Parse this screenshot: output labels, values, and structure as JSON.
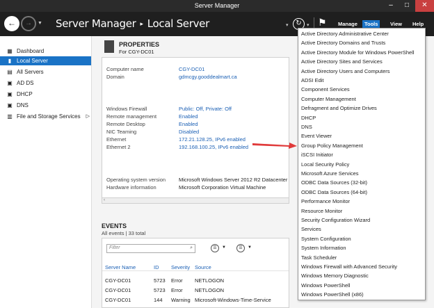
{
  "window": {
    "title": "Server Manager",
    "minimize": "–",
    "maximize": "□",
    "close": "✕"
  },
  "header": {
    "breadcrumb_root": "Server Manager",
    "breadcrumb_separator": "▸",
    "breadcrumb_current": "Local Server",
    "back_icon": "←",
    "forward_icon": "→",
    "nav_dropdown_icon": "▼",
    "breadcrumb_dropdown_icon": "▾",
    "refresh_icon": "↻",
    "refresh_dropdown_icon": "▾",
    "flag_icon": "⚑",
    "menus": [
      "Manage",
      "Tools",
      "View",
      "Help"
    ]
  },
  "sidebar": {
    "items": [
      {
        "label": "Dashboard",
        "icon": "▦",
        "active": false
      },
      {
        "label": "Local Server",
        "icon": "▮",
        "active": true
      },
      {
        "label": "All Servers",
        "icon": "▤",
        "active": false
      },
      {
        "label": "AD DS",
        "icon": "▣",
        "active": false
      },
      {
        "label": "DHCP",
        "icon": "▣",
        "active": false
      },
      {
        "label": "DNS",
        "icon": "▣",
        "active": false
      },
      {
        "label": "File and Storage Services",
        "icon": "▥",
        "active": false,
        "chevron": "▷"
      }
    ]
  },
  "properties": {
    "title": "PROPERTIES",
    "subtitle": "For CGY-DC01",
    "rows": [
      {
        "key": "Computer name",
        "value": "CGY-DC01",
        "link": true
      },
      {
        "key": "Domain",
        "value": "gdmcgy.gooddealmart.ca",
        "link": true
      },
      {
        "key": "Windows Firewall",
        "value": "Public: Off, Private: Off",
        "link": true
      },
      {
        "key": "Remote management",
        "value": "Enabled",
        "link": true
      },
      {
        "key": "Remote Desktop",
        "value": "Enabled",
        "link": true
      },
      {
        "key": "NIC Teaming",
        "value": "Disabled",
        "link": true
      },
      {
        "key": "Ethernet",
        "value": "172.21.128.25, IPv6 enabled",
        "link": true
      },
      {
        "key": "Ethernet 2",
        "value": "192.168.100.25, IPv6 enabled",
        "link": true
      },
      {
        "key": "Operating system version",
        "value": "Microsoft Windows Server 2012 R2 Datacenter",
        "link": false
      },
      {
        "key": "Hardware information",
        "value": "Microsoft Corporation Virtual Machine",
        "link": false
      }
    ],
    "scroll_left_icon": "‹"
  },
  "events": {
    "title": "EVENTS",
    "subtitle": "All events | 33 total",
    "filter_placeholder": "Filter",
    "filter_icon": "⌕",
    "options_icon_1": "☰",
    "options_icon_2": "☰",
    "dropdown_icon": "▼",
    "columns": [
      "Server Name",
      "ID",
      "Severity",
      "Source"
    ],
    "rows": [
      [
        "CGY-DC01",
        "5723",
        "Error",
        "NETLOGON"
      ],
      [
        "CGY-DC01",
        "5723",
        "Error",
        "NETLOGON"
      ],
      [
        "CGY-DC01",
        "144",
        "Warning",
        "Microsoft-Windows-Time-Service"
      ]
    ]
  },
  "tools_menu": {
    "items": [
      "Active Directory Administrative Center",
      "Active Directory Domains and Trusts",
      "Active Directory Module for Windows PowerShell",
      "Active Directory Sites and Services",
      "Active Directory Users and Computers",
      "ADSI Edit",
      "Component Services",
      "Computer Management",
      "Defragment and Optimize Drives",
      "DHCP",
      "DNS",
      "Event Viewer",
      "Group Policy Management",
      "iSCSI Initiator",
      "Local Security Policy",
      "Microsoft Azure Services",
      "ODBC Data Sources (32-bit)",
      "ODBC Data Sources (64-bit)",
      "Performance Monitor",
      "Resource Monitor",
      "Security Configuration Wizard",
      "Services",
      "System Configuration",
      "System Information",
      "Task Scheduler",
      "Windows Firewall with Advanced Security",
      "Windows Memory Diagnostic",
      "Windows PowerShell",
      "Windows PowerShell (x86)"
    ]
  },
  "colors": {
    "accent": "#1a73c6",
    "arrow": "#e03a3a"
  }
}
